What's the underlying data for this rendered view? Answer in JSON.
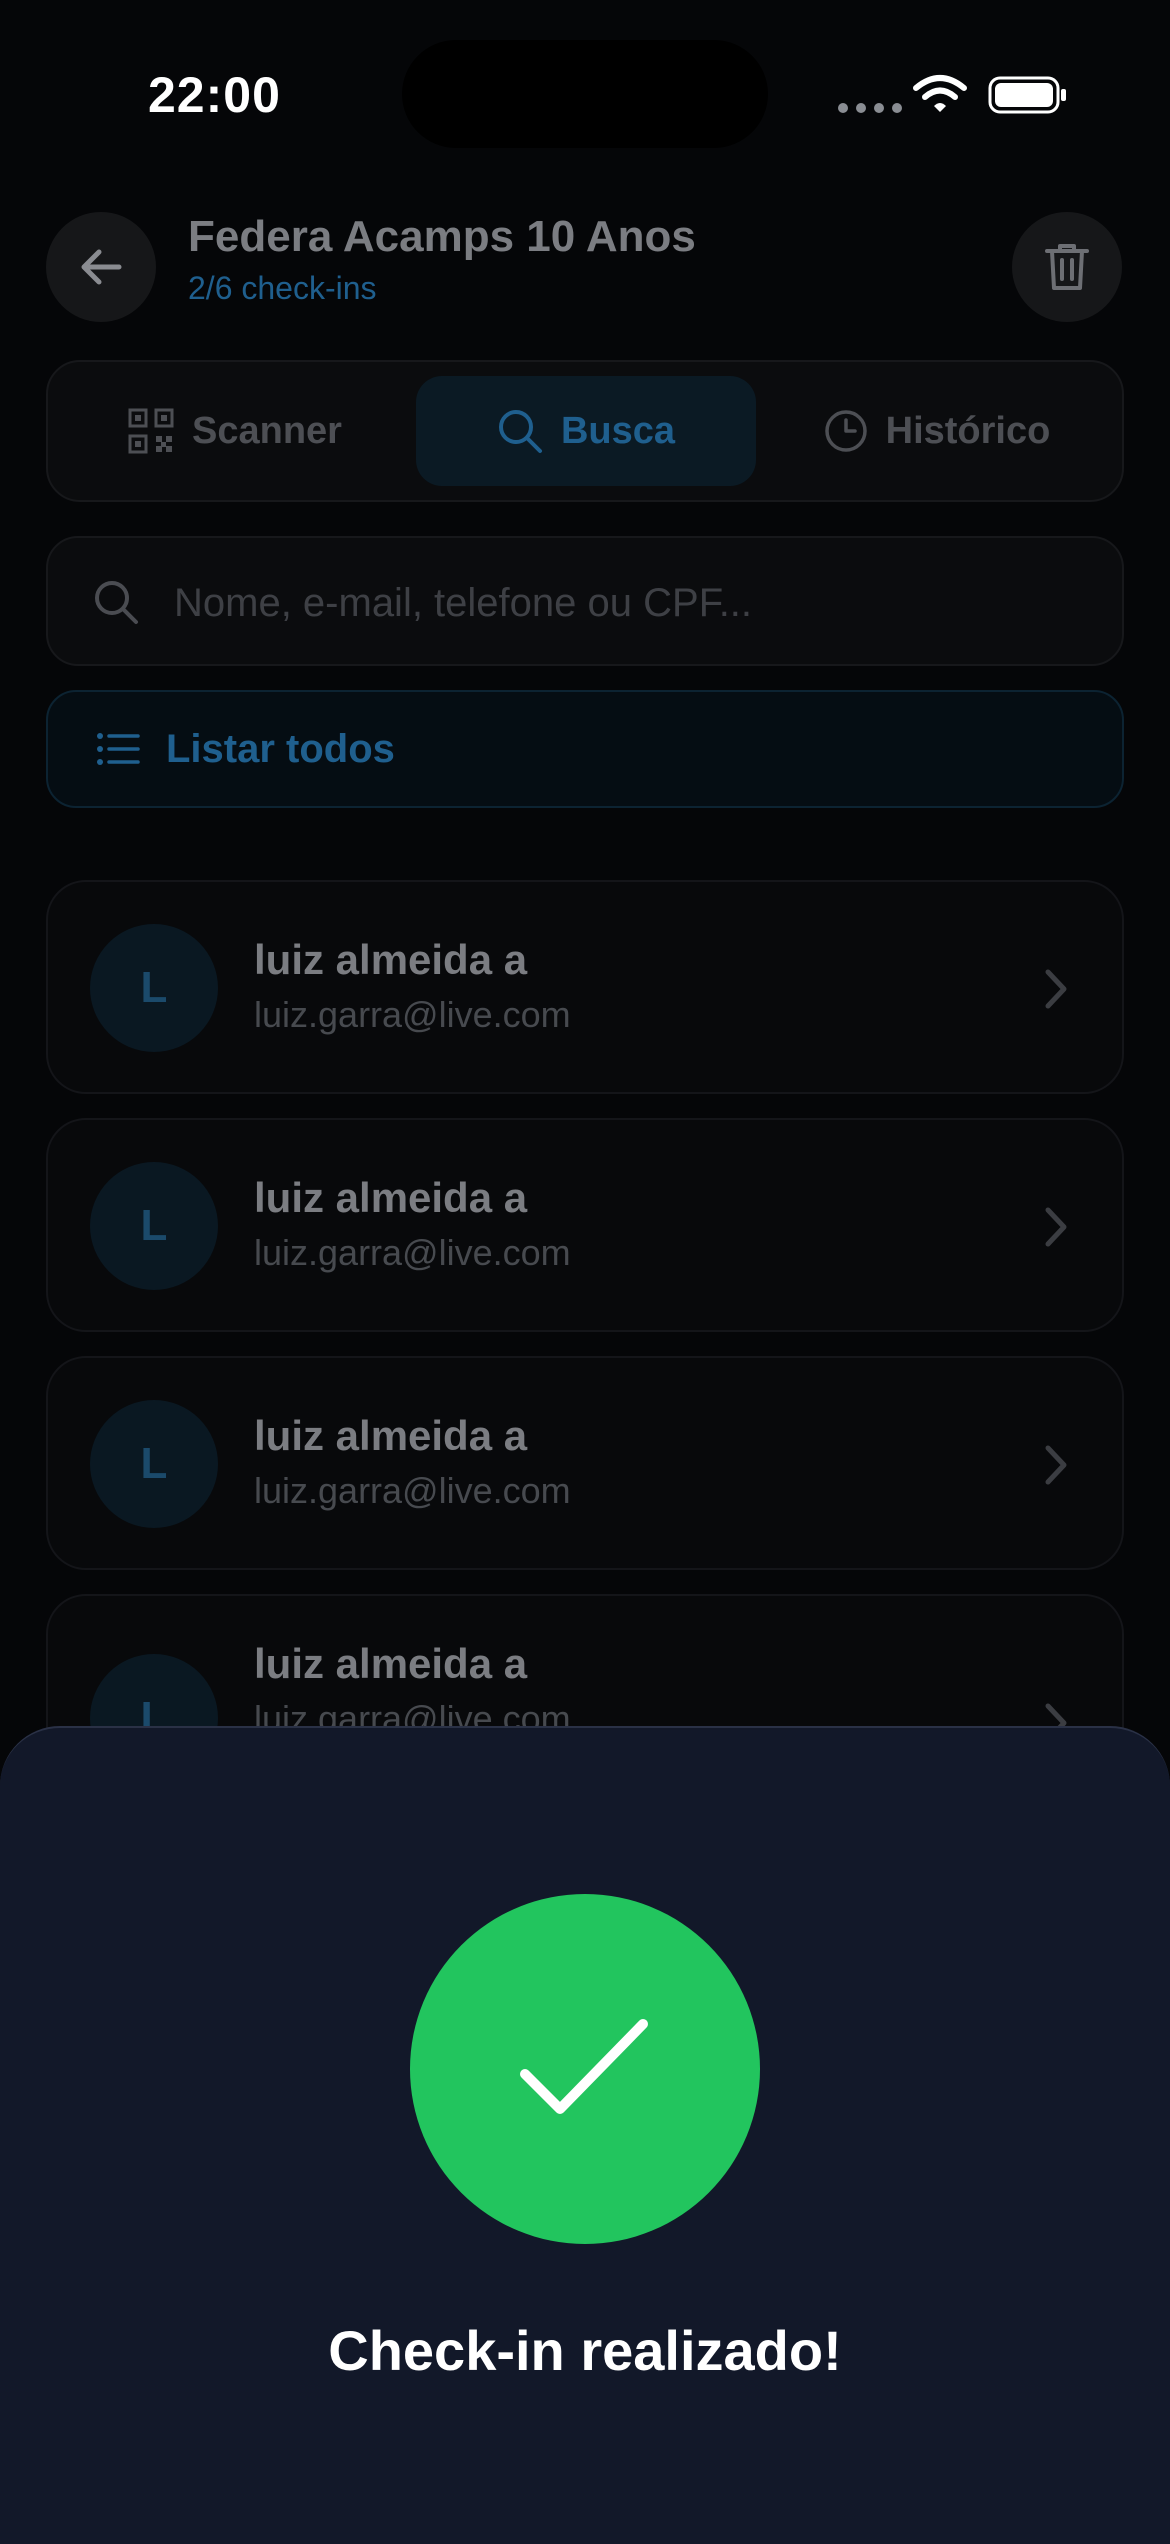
{
  "status_bar": {
    "time": "22:00"
  },
  "header": {
    "title": "Federa Acamps 10 Anos",
    "subtitle": "2/6 check-ins"
  },
  "tabs": [
    {
      "label": "Scanner",
      "icon": "qr-code-icon",
      "active": false
    },
    {
      "label": "Busca",
      "icon": "search-icon",
      "active": true
    },
    {
      "label": "Histórico",
      "icon": "clock-icon",
      "active": false
    }
  ],
  "search": {
    "placeholder": "Nome, e-mail, telefone ou CPF..."
  },
  "list_all": {
    "label": "Listar todos"
  },
  "results": [
    {
      "initial": "L",
      "name": "luiz almeida a",
      "email": "luiz.garra@live.com"
    },
    {
      "initial": "L",
      "name": "luiz almeida a",
      "email": "luiz.garra@live.com"
    },
    {
      "initial": "L",
      "name": "luiz almeida a",
      "email": "luiz.garra@live.com"
    },
    {
      "initial": "L",
      "name": "luiz almeida a",
      "email": "luiz.garra@live.com"
    }
  ],
  "sheet": {
    "title": "Check-in realizado!"
  },
  "colors": {
    "accent": "#1f5f8e",
    "success": "#22c55e",
    "sheet_bg": "#121829"
  }
}
